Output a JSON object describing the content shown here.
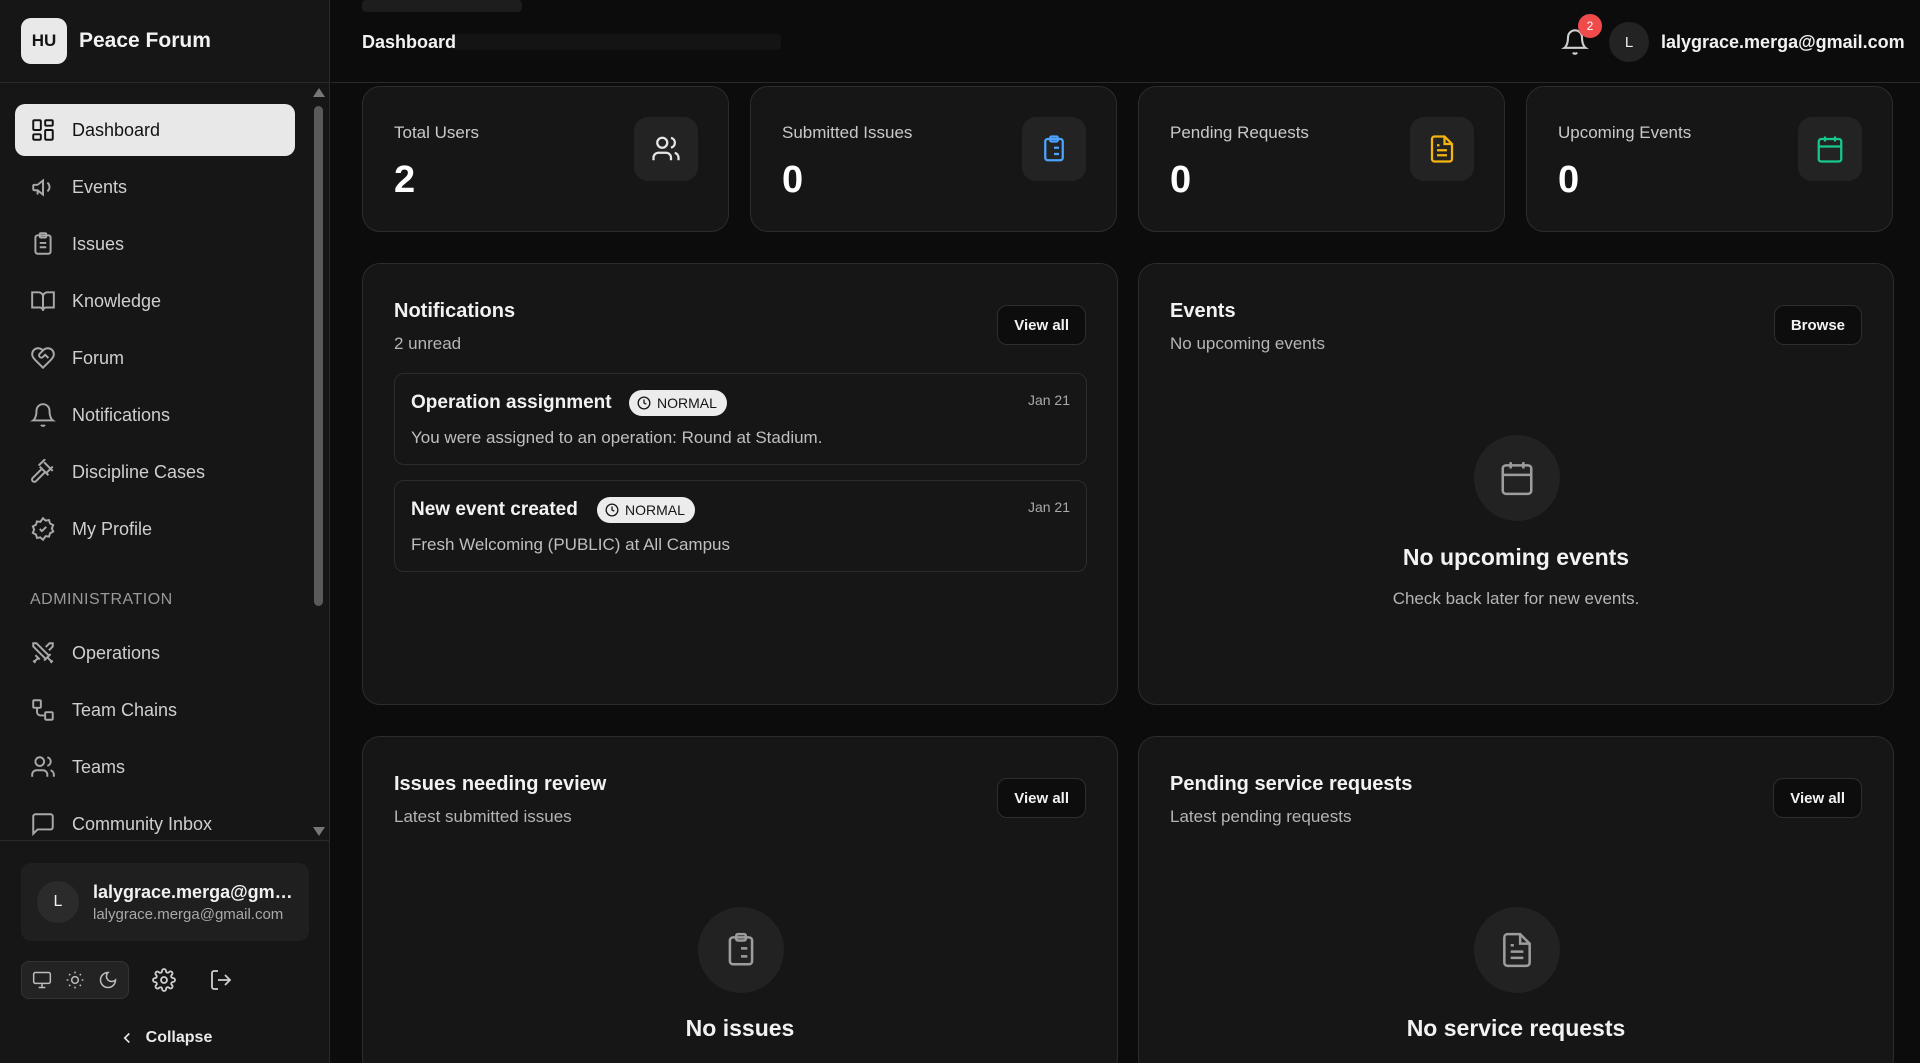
{
  "brand": {
    "logo_text": "HU",
    "name": "Peace Forum"
  },
  "sidebar": {
    "items": [
      {
        "label": "Dashboard",
        "icon": "dashboard-icon",
        "active": true
      },
      {
        "label": "Events",
        "icon": "megaphone-icon"
      },
      {
        "label": "Issues",
        "icon": "clipboard-icon"
      },
      {
        "label": "Knowledge",
        "icon": "book-icon"
      },
      {
        "label": "Forum",
        "icon": "heart-handshake-icon"
      },
      {
        "label": "Notifications",
        "icon": "bell-icon"
      },
      {
        "label": "Discipline Cases",
        "icon": "gavel-icon"
      },
      {
        "label": "My Profile",
        "icon": "badge-check-icon"
      }
    ],
    "section_label": "ADMINISTRATION",
    "admin_items": [
      {
        "label": "Operations",
        "icon": "swords-icon"
      },
      {
        "label": "Team Chains",
        "icon": "chain-icon"
      },
      {
        "label": "Teams",
        "icon": "users-icon"
      },
      {
        "label": "Community Inbox",
        "icon": "message-square-icon"
      }
    ],
    "user": {
      "initial": "L",
      "name": "lalygrace.merga@gmail.com",
      "email": "lalygrace.merga@gmail.com"
    },
    "collapse_label": "Collapse"
  },
  "header": {
    "title": "Dashboard",
    "notification_count": "2",
    "avatar_initial": "L",
    "email": "lalygrace.merga@gmail.com"
  },
  "stats": [
    {
      "label": "Total Users",
      "value": "2",
      "icon": "users-icon",
      "color": "#e6e6e6"
    },
    {
      "label": "Submitted Issues",
      "value": "0",
      "icon": "clipboard-list-icon",
      "color": "#4da3ff"
    },
    {
      "label": "Pending Requests",
      "value": "0",
      "icon": "file-text-icon",
      "color": "#f5b50e"
    },
    {
      "label": "Upcoming Events",
      "value": "0",
      "icon": "calendar-icon",
      "color": "#17c98b"
    }
  ],
  "notifications_panel": {
    "title": "Notifications",
    "subtitle": "2 unread",
    "button": "View all",
    "items": [
      {
        "title": "Operation assignment",
        "badge": "NORMAL",
        "date": "Jan 21",
        "body": "You were assigned to an operation: Round at Stadium."
      },
      {
        "title": "New event created",
        "badge": "NORMAL",
        "date": "Jan 21",
        "body": "Fresh Welcoming (PUBLIC) at All Campus"
      }
    ]
  },
  "events_panel": {
    "title": "Events",
    "subtitle": "No upcoming events",
    "button": "Browse",
    "empty_title": "No upcoming events",
    "empty_sub": "Check back later for new events."
  },
  "issues_panel": {
    "title": "Issues needing review",
    "subtitle": "Latest submitted issues",
    "button": "View all",
    "empty_title": "No issues"
  },
  "requests_panel": {
    "title": "Pending service requests",
    "subtitle": "Latest pending requests",
    "button": "View all",
    "empty_title": "No service requests"
  }
}
